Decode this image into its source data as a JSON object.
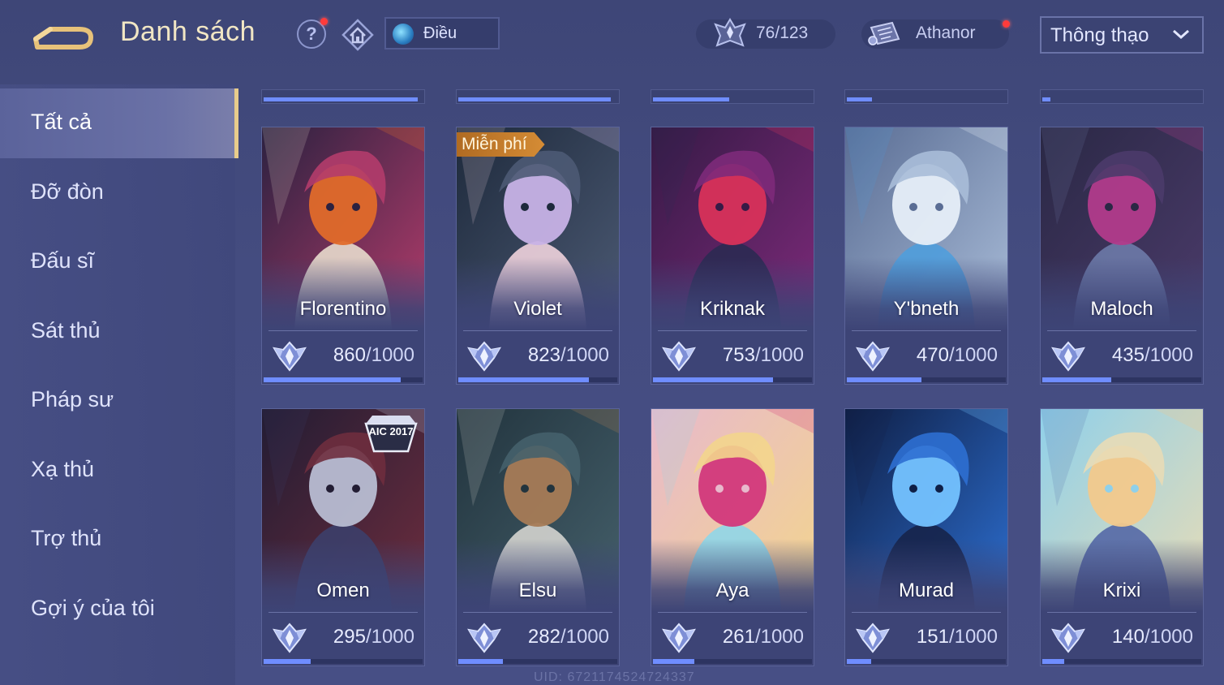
{
  "header": {
    "title": "Danh sách",
    "filter_label": "Điều",
    "mastery_count": "76/123",
    "player_name": "Athanor",
    "sort_selected": "Thông thạo"
  },
  "sidebar": {
    "items": [
      {
        "label": "Tất cả"
      },
      {
        "label": "Đỡ đòn"
      },
      {
        "label": "Đấu sĩ"
      },
      {
        "label": "Sát thủ"
      },
      {
        "label": "Pháp sư"
      },
      {
        "label": "Xạ thủ"
      },
      {
        "label": "Trợ thủ"
      },
      {
        "label": "Gợi ý của tôi"
      }
    ],
    "active_index": 0
  },
  "previous_row_progress": [
    0.97,
    0.96,
    0.48,
    0.16,
    0.05
  ],
  "heroes": [
    {
      "name": "Florentino",
      "points": "860",
      "max": "/1000",
      "progress": 0.86,
      "palette": [
        "#2b2140",
        "#b33c6b",
        "#e06a2a",
        "#e8dccd"
      ]
    },
    {
      "name": "Violet",
      "points": "823",
      "max": "/1000",
      "progress": 0.823,
      "palette": [
        "#1e2a3c",
        "#4c5a74",
        "#c7b2e6",
        "#efd3dd"
      ],
      "badge": "Miễn phí"
    },
    {
      "name": "Kriknak",
      "points": "753",
      "max": "/1000",
      "progress": 0.753,
      "palette": [
        "#361a46",
        "#7d2a7a",
        "#d8325a",
        "#2b2a52"
      ]
    },
    {
      "name": "Y'bneth",
      "points": "470",
      "max": "/1000",
      "progress": 0.47,
      "palette": [
        "#5a6d94",
        "#a9bcd8",
        "#e6eef8",
        "#4f9ddc"
      ]
    },
    {
      "name": "Maloch",
      "points": "435",
      "max": "/1000",
      "progress": 0.435,
      "palette": [
        "#2a2845",
        "#4b3b6a",
        "#b13b8b",
        "#6d7aa8"
      ]
    },
    {
      "name": "Omen",
      "points": "295",
      "max": "/1000",
      "progress": 0.295,
      "palette": [
        "#221c33",
        "#6e2d3e",
        "#b8bdd2",
        "#3c3f6a"
      ],
      "event": "AIC 2017"
    },
    {
      "name": "Elsu",
      "points": "282",
      "max": "/1000",
      "progress": 0.282,
      "palette": [
        "#22343e",
        "#45606b",
        "#a77b56",
        "#d4d4cf"
      ]
    },
    {
      "name": "Aya",
      "points": "261",
      "max": "/1000",
      "progress": 0.261,
      "palette": [
        "#e8b9cc",
        "#f3d58d",
        "#d2387b",
        "#8fd6e8"
      ]
    },
    {
      "name": "Murad",
      "points": "151",
      "max": "/1000",
      "progress": 0.151,
      "palette": [
        "#0f1f46",
        "#2d6fd1",
        "#74c2ff",
        "#16244a"
      ]
    },
    {
      "name": "Krixi",
      "points": "140",
      "max": "/1000",
      "progress": 0.14,
      "palette": [
        "#8fd0ea",
        "#e8dcb6",
        "#f2c98c",
        "#5468a6"
      ]
    }
  ],
  "footer": {
    "uid": "UID: 6721174524724337"
  },
  "colors": {
    "accent_gold": "#e8cc8b",
    "progress_blue": "#6f8dff",
    "notification_red": "#ff3b3b"
  }
}
